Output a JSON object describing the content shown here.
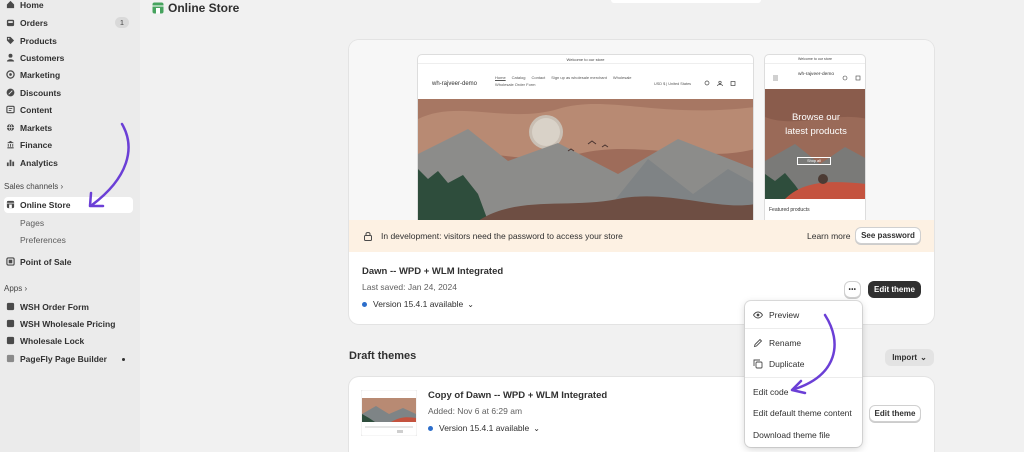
{
  "sidebar": {
    "items": [
      {
        "label": "Home",
        "icon": "home-icon"
      },
      {
        "label": "Orders",
        "icon": "inbox-icon",
        "badge": "1"
      },
      {
        "label": "Products",
        "icon": "tag-icon"
      },
      {
        "label": "Customers",
        "icon": "person-icon"
      },
      {
        "label": "Marketing",
        "icon": "target-icon"
      },
      {
        "label": "Discounts",
        "icon": "discount-icon"
      },
      {
        "label": "Content",
        "icon": "content-icon"
      },
      {
        "label": "Markets",
        "icon": "globe-icon"
      },
      {
        "label": "Finance",
        "icon": "bank-icon"
      },
      {
        "label": "Analytics",
        "icon": "chart-icon"
      }
    ],
    "sales_channels_label": "Sales channels",
    "online_store": "Online Store",
    "pages": "Pages",
    "preferences": "Preferences",
    "point_of_sale": "Point of Sale",
    "apps_label": "Apps",
    "apps": [
      {
        "label": "WSH Order Form"
      },
      {
        "label": "WSH Wholesale Pricing"
      },
      {
        "label": "Wholesale Lock"
      },
      {
        "label": "PageFly Page Builder"
      }
    ]
  },
  "header": {
    "title": "Online Store"
  },
  "preview": {
    "announcement": "Welcome to our store",
    "store_name": "wh-rajveer-demo",
    "nav": [
      "Home",
      "Catalog",
      "Contact",
      "Sign up as wholesale merchant",
      "Wholesale",
      "Wholesale Order Form"
    ],
    "currency": "USD $ | United States",
    "mobile_heading_1": "Browse our",
    "mobile_heading_2": "latest products",
    "mobile_button": "Shop all",
    "mobile_featured": "Featured products"
  },
  "banner": {
    "text": "In development: visitors need the password to access your store",
    "learn_more": "Learn more",
    "see_password": "See password"
  },
  "current_theme": {
    "name": "Dawn -- WPD + WLM Integrated",
    "saved": "Last saved: Jan 24, 2024",
    "version": "Version 15.4.1 available",
    "edit_button": "Edit theme",
    "more_button": "•••"
  },
  "dropdown_menu": {
    "items": [
      "Preview",
      "Rename",
      "Duplicate",
      "Edit code",
      "Edit default theme content",
      "Download theme file"
    ]
  },
  "draft": {
    "section_title": "Draft themes",
    "import_button": "Import",
    "name": "Copy of Dawn -- WPD + WLM Integrated",
    "added": "Added: Nov 6 at 6:29 am",
    "version": "Version 15.4.1 available",
    "edit_button": "Edit theme"
  },
  "colors": {
    "accent_arrow": "#6b3fd6",
    "banner_bg": "#fdf1e3",
    "version_dot": "#2c6ecb",
    "active_bg": "#ffffff"
  }
}
